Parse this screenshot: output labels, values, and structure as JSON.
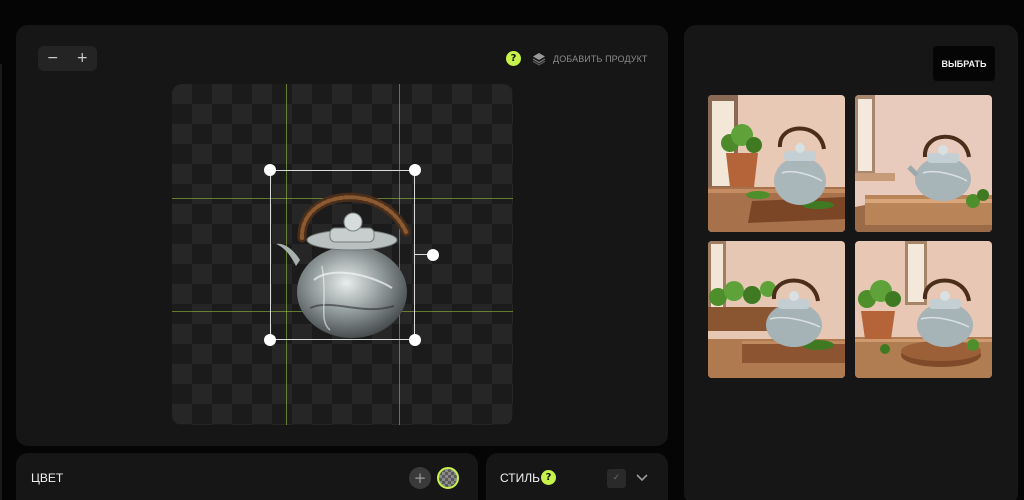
{
  "editor": {
    "zoom_out_label": "−",
    "zoom_in_label": "+",
    "help_label": "?",
    "add_product_label": "ДОБАВИТЬ ПРОДУКТ"
  },
  "results": {
    "select_label": "ВЫБРАТЬ"
  },
  "color_panel": {
    "label": "ЦВЕТ",
    "add_label": "+"
  },
  "style_panel": {
    "label": "СТИЛЬ",
    "help_label": "?",
    "check_label": "✓"
  },
  "colors": {
    "accent": "#c7f24a",
    "panel": "#161616",
    "background": "#050505"
  },
  "icons": [
    "minus-icon",
    "plus-icon",
    "help-icon",
    "layers-icon",
    "chevron-down-icon",
    "check-icon"
  ]
}
